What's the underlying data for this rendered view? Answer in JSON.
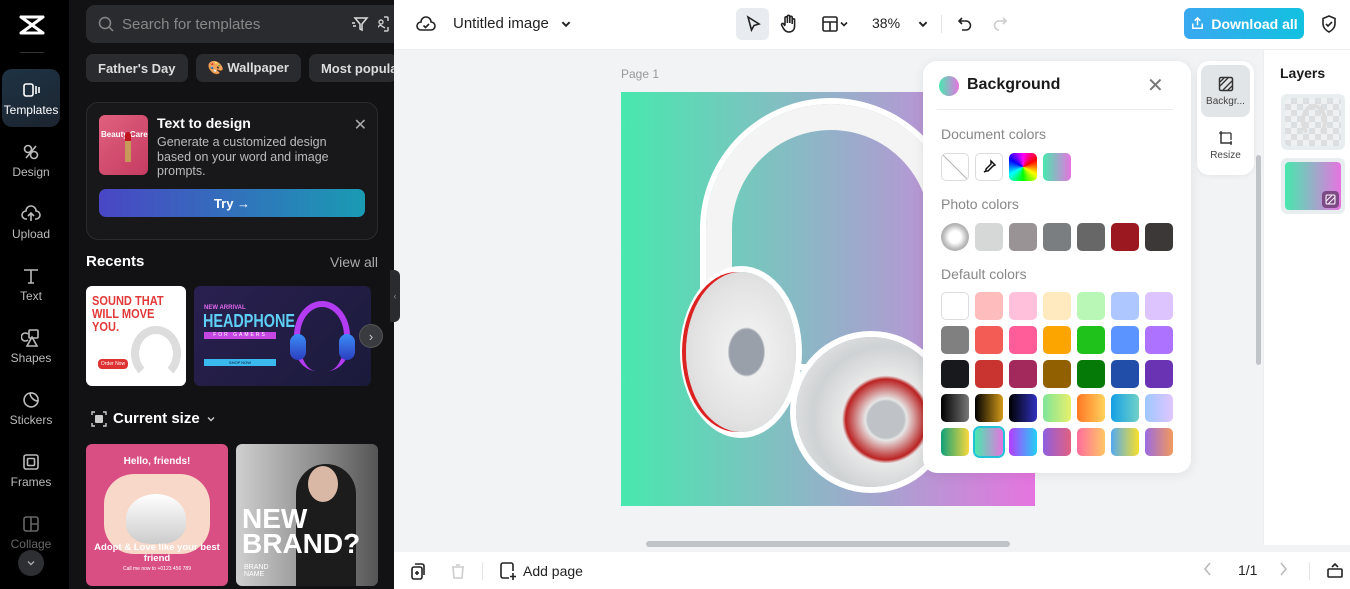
{
  "rail": {
    "items": [
      {
        "label": "Templates",
        "icon": "templates-icon",
        "active": true
      },
      {
        "label": "Design",
        "icon": "design-icon"
      },
      {
        "label": "Upload",
        "icon": "upload-cloud-icon"
      },
      {
        "label": "Text",
        "icon": "text-icon"
      },
      {
        "label": "Shapes",
        "icon": "shapes-icon"
      },
      {
        "label": "Stickers",
        "icon": "sticker-icon"
      },
      {
        "label": "Frames",
        "icon": "frame-icon"
      },
      {
        "label": "Collage",
        "icon": "collage-icon"
      }
    ]
  },
  "panel": {
    "search_placeholder": "Search for templates",
    "chips": [
      "Father's Day",
      "🎨 Wallpaper",
      "Most popular"
    ],
    "text_to_design": {
      "thumb_text": "Beauty Care",
      "title": "Text to design",
      "description": "Generate a customized design based on your word and image prompts.",
      "try_label": "Try →"
    },
    "recents_title": "Recents",
    "view_all": "View all",
    "recents": [
      {
        "headline": "SOUND THAT WILL MOVE YOU.",
        "button": "Order Now"
      },
      {
        "kicker": "NEW ARRIVAL",
        "headline": "HEADPHONE",
        "sub": "FOR GAMERS",
        "button": "SHOP NOW"
      }
    ],
    "current_size_label": "Current size",
    "templates": [
      {
        "title": "Hello, friends!",
        "headline": "Adopt & Love like your best friend",
        "footer": "Call me now to +0123 456 789"
      },
      {
        "headline": "NEW BRAND?",
        "sub": "BRAND NAME"
      }
    ]
  },
  "topbar": {
    "title": "Untitled image",
    "zoom": "38%",
    "download_label": "Download all"
  },
  "canvas": {
    "page_label": "Page 1",
    "background_gradient": [
      "#48e8ae",
      "#e674e0"
    ]
  },
  "background_panel": {
    "title": "Background",
    "document_colors_label": "Document colors",
    "photo_colors_label": "Photo colors",
    "default_colors_label": "Default colors",
    "document_colors": [
      "none",
      "eyedropper",
      "rainbow",
      "linear-gradient(90deg,#48e8ae,#e674e0)"
    ],
    "photo_colors": [
      "#d6d8d7",
      "#999395",
      "#7b7e80",
      "#676767",
      "#9b1820",
      "#3c3838"
    ],
    "default_colors": [
      "#ffffff",
      "#ffbcbc",
      "#ffc0dc",
      "#ffe9bf",
      "#b8f7b6",
      "#aec8ff",
      "#dec4ff",
      "#808080",
      "#f25c54",
      "#ff5c9a",
      "#fca500",
      "#1ec21a",
      "#5b94ff",
      "#ad72ff",
      "#18191d",
      "#c93430",
      "#a3285c",
      "#916000",
      "#057a06",
      "#204ea8",
      "#6a33b3",
      "linear-gradient(90deg,#000,#777)",
      "linear-gradient(90deg,#000,#d49a1a)",
      "linear-gradient(90deg,#000,#3030c0)",
      "linear-gradient(90deg,#7de59a,#e8f06a)",
      "linear-gradient(90deg,#ff7724,#ffd35c)",
      "linear-gradient(90deg,#13a0e6,#72d1c7)",
      "linear-gradient(90deg,#9ec7ff,#e0c6ff)",
      "linear-gradient(90deg,#12a07a,#f8d83c)",
      "linear-gradient(90deg,#48e8ae,#e674e0)",
      "linear-gradient(90deg,#b43cff,#22d0f5)",
      "linear-gradient(90deg,#8e5ee0,#e26180)",
      "linear-gradient(90deg,#ff6d9e,#ffc764)",
      "linear-gradient(90deg,#52a9f0,#f8e02a)",
      "linear-gradient(90deg,#9b6ae0,#f29a5c)"
    ],
    "selected_default_index": 29
  },
  "side_tools": [
    {
      "label": "Backgr...",
      "icon": "background-icon",
      "active": true
    },
    {
      "label": "Resize",
      "icon": "resize-icon"
    }
  ],
  "layers": {
    "title": "Layers"
  },
  "bottombar": {
    "add_page_label": "Add page",
    "page_counter": "1/1"
  }
}
